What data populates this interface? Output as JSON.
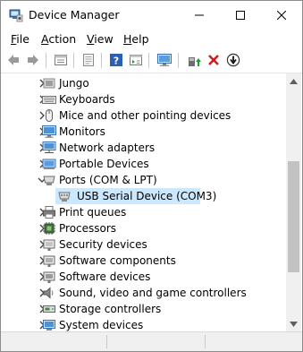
{
  "window": {
    "title": "Device Manager"
  },
  "menu": [
    {
      "label": "File",
      "accel": "F",
      "rest": "ile"
    },
    {
      "label": "Action",
      "accel": "A",
      "rest": "ction"
    },
    {
      "label": "View",
      "accel": "V",
      "rest": "iew"
    },
    {
      "label": "Help",
      "accel": "H",
      "rest": "elp"
    }
  ],
  "toolbar_icons": [
    "back-icon",
    "forward-icon",
    "properties-list-icon",
    "show-hidden-icon",
    "help-icon",
    "action-pane-icon",
    "computer-monitor-icon",
    "update-driver-icon",
    "uninstall-icon",
    "disable-device-icon"
  ],
  "tree": [
    {
      "label": "Jungo",
      "icon": "jungo-icon",
      "expanded": false
    },
    {
      "label": "Keyboards",
      "icon": "keyboard-icon",
      "expanded": false
    },
    {
      "label": "Mice and other pointing devices",
      "icon": "mouse-icon",
      "expanded": false
    },
    {
      "label": "Monitors",
      "icon": "monitor-icon",
      "expanded": false
    },
    {
      "label": "Network adapters",
      "icon": "network-adapter-icon",
      "expanded": false
    },
    {
      "label": "Portable Devices",
      "icon": "portable-device-icon",
      "expanded": false
    },
    {
      "label": "Ports (COM & LPT)",
      "icon": "port-icon",
      "expanded": true
    },
    {
      "label": "USB Serial Device (COM3)",
      "icon": "serial-port-icon",
      "child": true,
      "selected": true
    },
    {
      "label": "Print queues",
      "icon": "printer-icon",
      "expanded": false
    },
    {
      "label": "Processors",
      "icon": "processor-icon",
      "expanded": false
    },
    {
      "label": "Security devices",
      "icon": "security-device-icon",
      "expanded": false
    },
    {
      "label": "Software components",
      "icon": "software-component-icon",
      "expanded": false
    },
    {
      "label": "Software devices",
      "icon": "software-device-icon",
      "expanded": false
    },
    {
      "label": "Sound, video and game controllers",
      "icon": "speaker-icon",
      "expanded": false
    },
    {
      "label": "Storage controllers",
      "icon": "storage-controller-icon",
      "expanded": false
    },
    {
      "label": "System devices",
      "icon": "system-device-icon",
      "expanded": false
    }
  ],
  "scrollbar": {
    "position": 0.62,
    "visible_fraction": 0.49
  },
  "colors": {
    "selection": "#cce8ff",
    "scroll_thumb": "#c2c2c2"
  }
}
